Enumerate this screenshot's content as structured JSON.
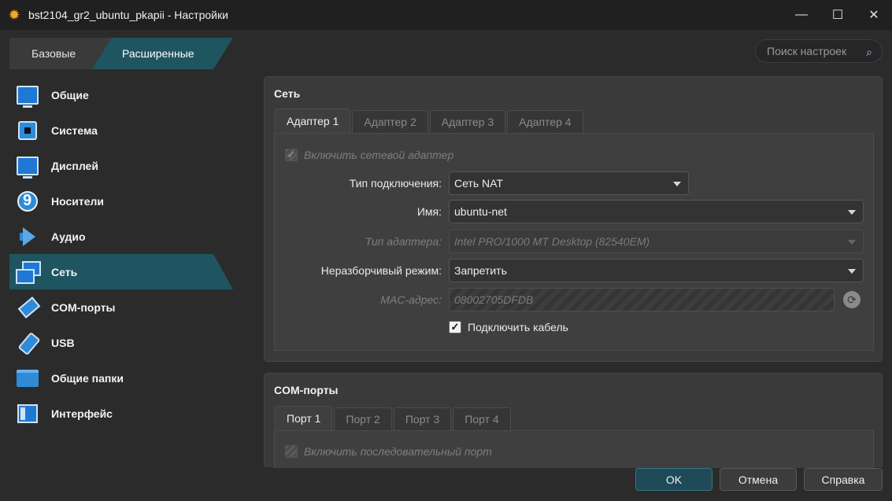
{
  "window": {
    "title": "bst2104_gr2_ubuntu_pkapii - Настройки",
    "icon": "gear-icon",
    "controls": [
      "minimize-icon",
      "maximize-icon",
      "close-icon"
    ]
  },
  "mode": {
    "basic": "Базовые",
    "advanced": "Расширенные",
    "selected": "Расширенные"
  },
  "search": {
    "placeholder": "Поиск настроек"
  },
  "sidebar": {
    "items": [
      {
        "label": "Общие",
        "icon": "monitor-icon"
      },
      {
        "label": "Система",
        "icon": "chip-icon"
      },
      {
        "label": "Дисплей",
        "icon": "display-icon"
      },
      {
        "label": "Носители",
        "icon": "disk-icon"
      },
      {
        "label": "Аудио",
        "icon": "speaker-icon"
      },
      {
        "label": "Сеть",
        "icon": "network-icon"
      },
      {
        "label": "COM-порты",
        "icon": "serial-port-icon"
      },
      {
        "label": "USB",
        "icon": "usb-icon"
      },
      {
        "label": "Общие папки",
        "icon": "folder-icon"
      },
      {
        "label": "Интерфейс",
        "icon": "ui-icon"
      }
    ],
    "selected": "Сеть"
  },
  "network": {
    "title": "Сеть",
    "tabs": [
      "Адаптер 1",
      "Адаптер 2",
      "Адаптер 3",
      "Адаптер 4"
    ],
    "enable_adapter": "Включить сетевой адаптер",
    "attached_label": "Тип подключения:",
    "attached_value": "Сеть NAT",
    "name_label": "Имя:",
    "name_value": "ubuntu-net",
    "adapter_type_label": "Тип адаптера:",
    "adapter_type_value": "Intel PRO/1000 MT Desktop (82540EM)",
    "promisc_label": "Неразборчивый режим:",
    "promisc_value": "Запретить",
    "mac_label": "MAC-адрес:",
    "mac_value": "08002705DFDB",
    "cable": "Подключить кабель",
    "cable_checked": true
  },
  "com": {
    "title": "COM-порты",
    "tabs": [
      "Порт 1",
      "Порт 2",
      "Порт 3",
      "Порт 4"
    ],
    "enable_port": "Включить последовательный порт"
  },
  "buttons": {
    "ok": "OK",
    "cancel": "Отмена",
    "help": "Справка"
  }
}
